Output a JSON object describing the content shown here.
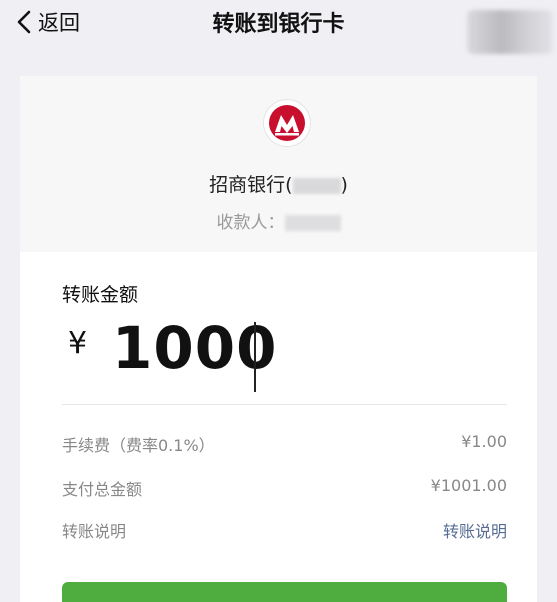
{
  "nav": {
    "back_label": "返回",
    "title": "转账到银行卡"
  },
  "bank": {
    "name_prefix": "招商银行(",
    "name_suffix": ")",
    "payee_label": "收款人：",
    "logo_color": "#c8102e"
  },
  "transfer": {
    "amount_label": "转账金额",
    "currency_symbol": "¥",
    "amount": "1000",
    "fee_label": "手续费（费率0.1%）",
    "fee_value": "¥1.00",
    "total_label": "支付总金额",
    "total_value": "¥1001.00",
    "note_label": "转账说明",
    "note_link": "转账说明",
    "confirm_color": "#4fad3f"
  }
}
